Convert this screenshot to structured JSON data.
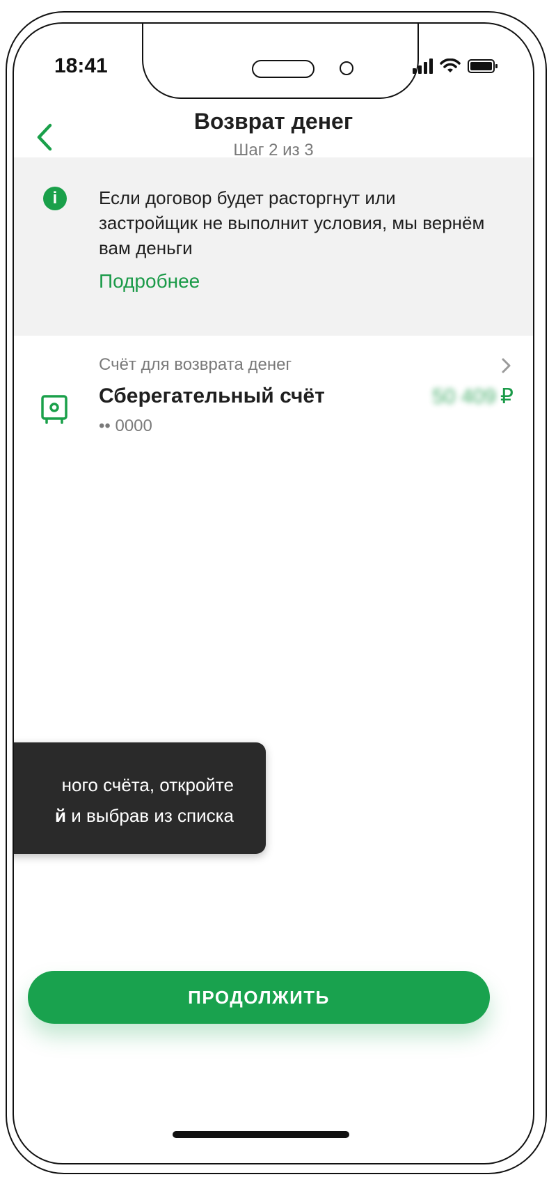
{
  "status_bar": {
    "time": "18:41"
  },
  "header": {
    "title": "Возврат денег",
    "subtitle": "Шаг 2 из 3"
  },
  "info": {
    "text": "Если договор будет расторгнут или застройщик не выполнит условия, мы вернём вам деньги",
    "link": "Подробнее"
  },
  "account": {
    "label": "Счёт для возврата денег",
    "name": "Сберегательный счёт",
    "number": "•• 0000",
    "balance": "50 409",
    "currency": "₽"
  },
  "tooltip": {
    "line1": "ного счёта, откройте",
    "line2_bold": "й",
    "line2_rest": " и выбрав из списка"
  },
  "actions": {
    "continue_label": "ПРОДОЛЖИТЬ"
  },
  "colors": {
    "accent": "#19a24e",
    "panel": "#f2f2f2",
    "tooltip_bg": "#2a2a2a"
  }
}
